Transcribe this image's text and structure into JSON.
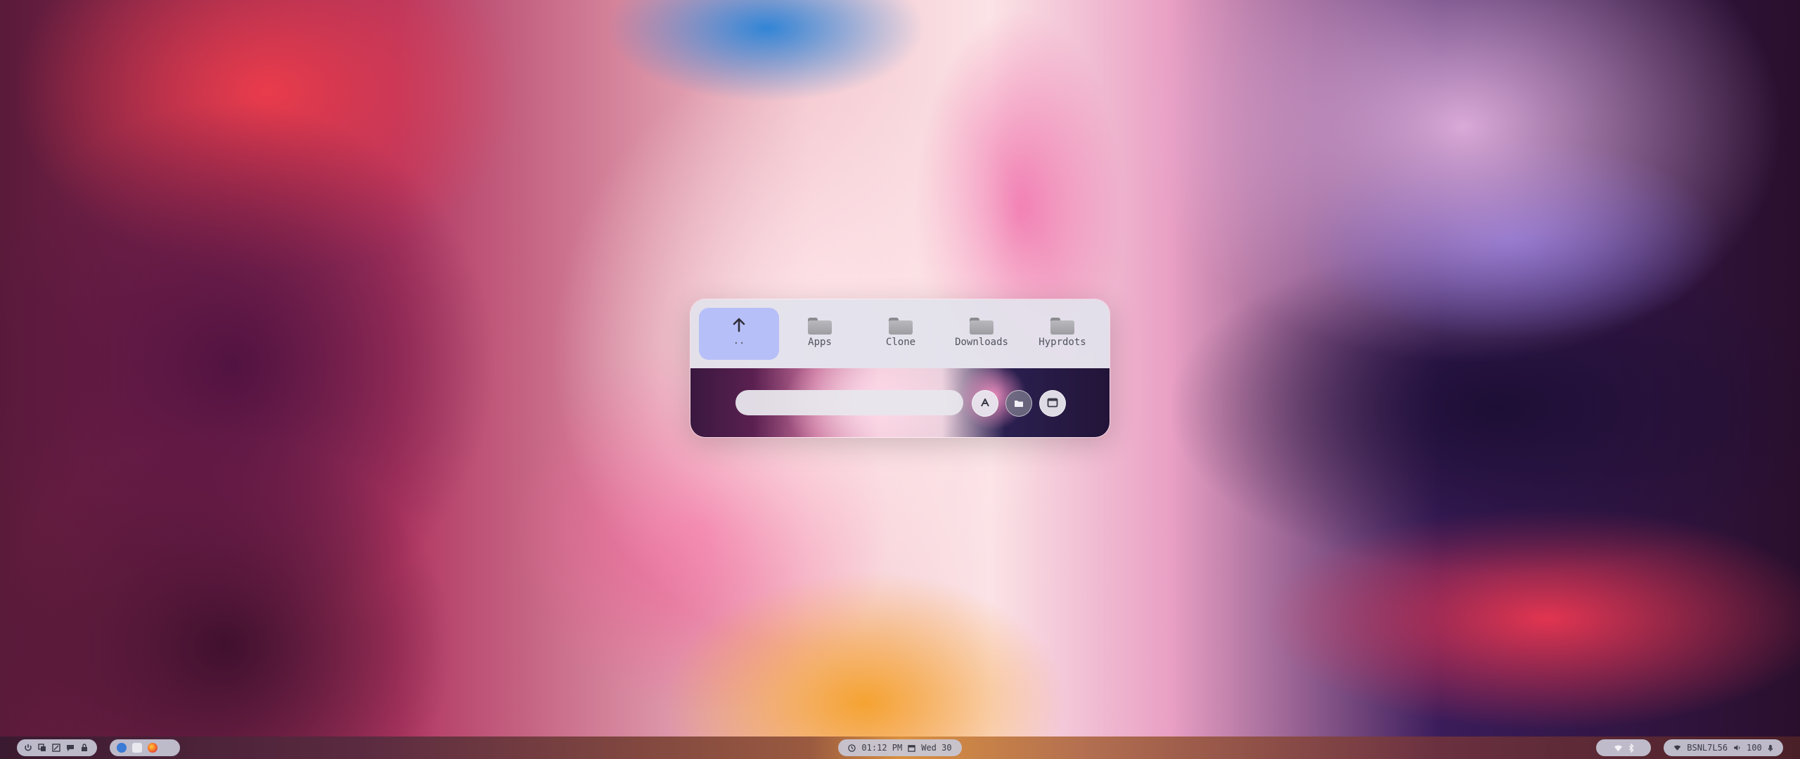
{
  "picker": {
    "entries": [
      {
        "label": "..",
        "icon": "arrow-up-icon",
        "selected": true
      },
      {
        "label": "Apps",
        "icon": "folder-icon"
      },
      {
        "label": "Clone",
        "icon": "folder-icon"
      },
      {
        "label": "Downloads",
        "icon": "folder-icon"
      },
      {
        "label": "Hyprdots",
        "icon": "folder-icon"
      }
    ],
    "search": {
      "value": "",
      "placeholder": ""
    },
    "buttons": [
      "text-mode-icon",
      "folder-icon",
      "window-icon"
    ],
    "accent_color": "#b7bff9"
  },
  "taskbar": {
    "left_icons": [
      "power-icon",
      "copy-icon",
      "fullscreen-icon",
      "chat-icon",
      "lock-icon"
    ],
    "apps": [
      "vscode-icon",
      "files-icon",
      "firefox-icon"
    ],
    "clock": {
      "time": "01:12 PM",
      "date": "Wed 30"
    },
    "tray": [
      "wifi-icon",
      "bluetooth-icon"
    ],
    "status": {
      "network": "BSNL7L56",
      "volume": "100"
    }
  }
}
